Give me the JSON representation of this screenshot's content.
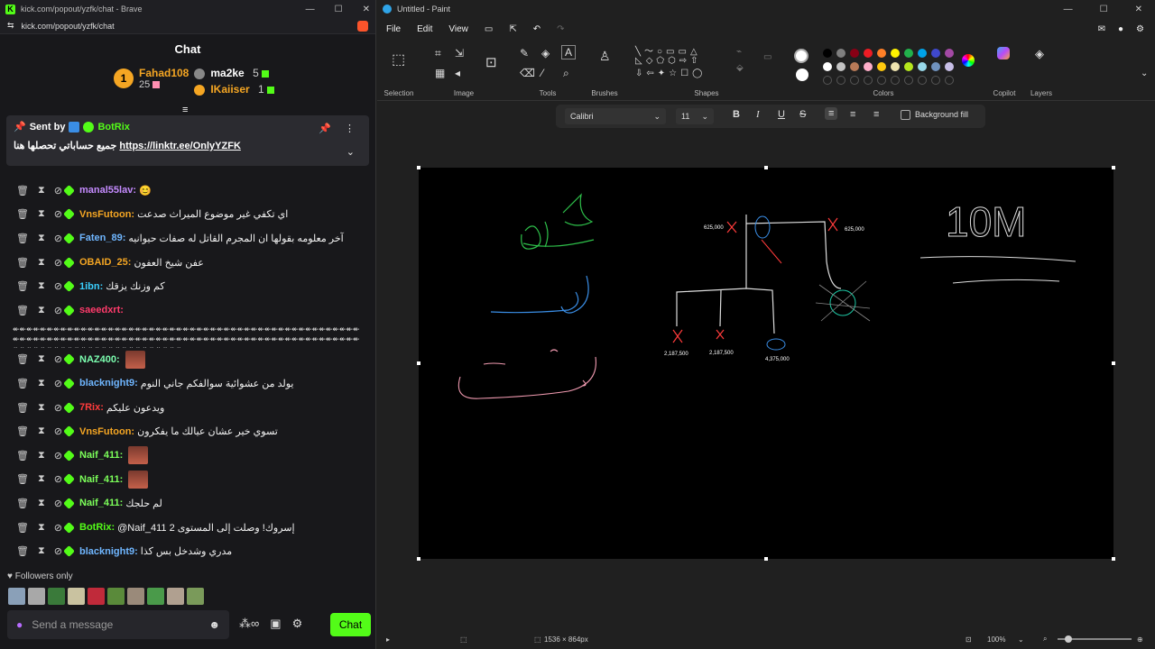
{
  "browser": {
    "title": "kick.com/popout/yzfk/chat - Brave",
    "url": "kick.com/popout/yzfk/chat"
  },
  "chat": {
    "header": "Chat",
    "leaders": [
      {
        "name": "Fahad108",
        "count": "25",
        "rank": "1"
      },
      {
        "name": "ma2ke",
        "count": "5"
      },
      {
        "name": "IKaiiser",
        "count": "1"
      }
    ],
    "pinned": {
      "sent_by": "Sent by",
      "author": "BotRix",
      "text_ar": "جميع حساباتي تحصلها هنا",
      "link": "https://linktr.ee/OnlyYZFK"
    },
    "messages": [
      {
        "user": "manal55lav:",
        "color": "#c58bff",
        "text": "😊",
        "emote": false
      },
      {
        "user": "VnsFutoon:",
        "color": "#f5a623",
        "text": "اي تكفي غير موضوع الميراث صدعت",
        "emote": false
      },
      {
        "user": "Faten_89:",
        "color": "#6fb6ff",
        "text": "آخر معلومه بقولها ان المجرم القاتل له صفات حيوانيه",
        "emote": false
      },
      {
        "user": "OBAID_25:",
        "color": "#f5a623",
        "text": "عفن شيخ العفون",
        "emote": false
      },
      {
        "user": "1ibn:",
        "color": "#3ad0ff",
        "text": "كم وزنك يزقك",
        "emote": false
      },
      {
        "user": "saeedxrt:",
        "color": "#ff3b6b",
        "text": "",
        "emote": false
      },
      {
        "user": "NAZ400:",
        "color": "#7cffb0",
        "text": "",
        "emote": true
      },
      {
        "user": "blacknight9:",
        "color": "#6fb6ff",
        "text": "يولد من عشوائية سوالفكم جاني النوم",
        "emote": false
      },
      {
        "user": "7Rix:",
        "color": "#ff3b3b",
        "text": "ويدعون عليكم",
        "emote": false
      },
      {
        "user": "VnsFutoon:",
        "color": "#f5a623",
        "text": "تسوي خير عشان عيالك ما يفكرون",
        "emote": false
      },
      {
        "user": "Naif_411:",
        "color": "#7cff5a",
        "text": "",
        "emote": true
      },
      {
        "user": "Naif_411:",
        "color": "#7cff5a",
        "text": "",
        "emote": true
      },
      {
        "user": "Naif_411:",
        "color": "#7cff5a",
        "text": "لم حلجك",
        "emote": false
      },
      {
        "user": "BotRix:",
        "color": "#53fc18",
        "text": "@Naif_411 إسروك! وصلت إلى المستوى 2",
        "emote": false
      },
      {
        "user": "blacknight9:",
        "color": "#6fb6ff",
        "text": "مدري وشدخل بس كذا",
        "emote": false
      }
    ],
    "spam_line": "↞↞↞↞↞↞↞↞↞↞↞↞↞↞↞↞↞↞↞↞↞↞↞↞↞↞↞↞↞↞↞↞↞↞↞↞↞↞↞↞↞↞↞↞↞↞↞↞↞↞↞↞↞↞↞↞↞↞↞↞↞↞↞↞↞↞↞↞↞↞↞↞↞↞↞↞↞↞↞↞↞↞↞↞↞↞↞↞↞↞↞↞↞↞↞↞↞↞↞↞↞↞↞↞↞↞↞↞↞↞↞↞↞↞↞↞↞↞↞↞↞↞↞↞↞↞↞",
    "followers_only": "Followers only",
    "input_placeholder": "Send a message",
    "chat_button": "Chat"
  },
  "paint": {
    "title": "Untitled - Paint",
    "menu": [
      "File",
      "Edit",
      "View"
    ],
    "groups": {
      "selection": "Selection",
      "image": "Image",
      "tools": "Tools",
      "brushes": "Brushes",
      "shapes": "Shapes",
      "colors": "Colors",
      "copilot": "Copilot",
      "layers": "Layers"
    },
    "font": "Calibri",
    "font_size": "11",
    "background_fill": "Background fill",
    "canvas_labels": {
      "left_top": "625,000",
      "right_top": "625,000",
      "bottom_left": "2,187,500",
      "bottom_mid": "2,187,500",
      "bottom_right": "4,375,000",
      "big": "10M"
    },
    "status": {
      "dimensions": "1536 × 864px",
      "zoom": "100%"
    },
    "palette": [
      "#000000",
      "#7f7f7f",
      "#880015",
      "#ed1c24",
      "#ff7f27",
      "#fff200",
      "#22b14c",
      "#00a2e8",
      "#3f48cc",
      "#a349a4",
      "#ffffff",
      "#c3c3c3",
      "#b97a57",
      "#ffaec9",
      "#ffc90e",
      "#efe4b0",
      "#b5e61d",
      "#99d9ea",
      "#7092be",
      "#c8bfe7"
    ]
  }
}
